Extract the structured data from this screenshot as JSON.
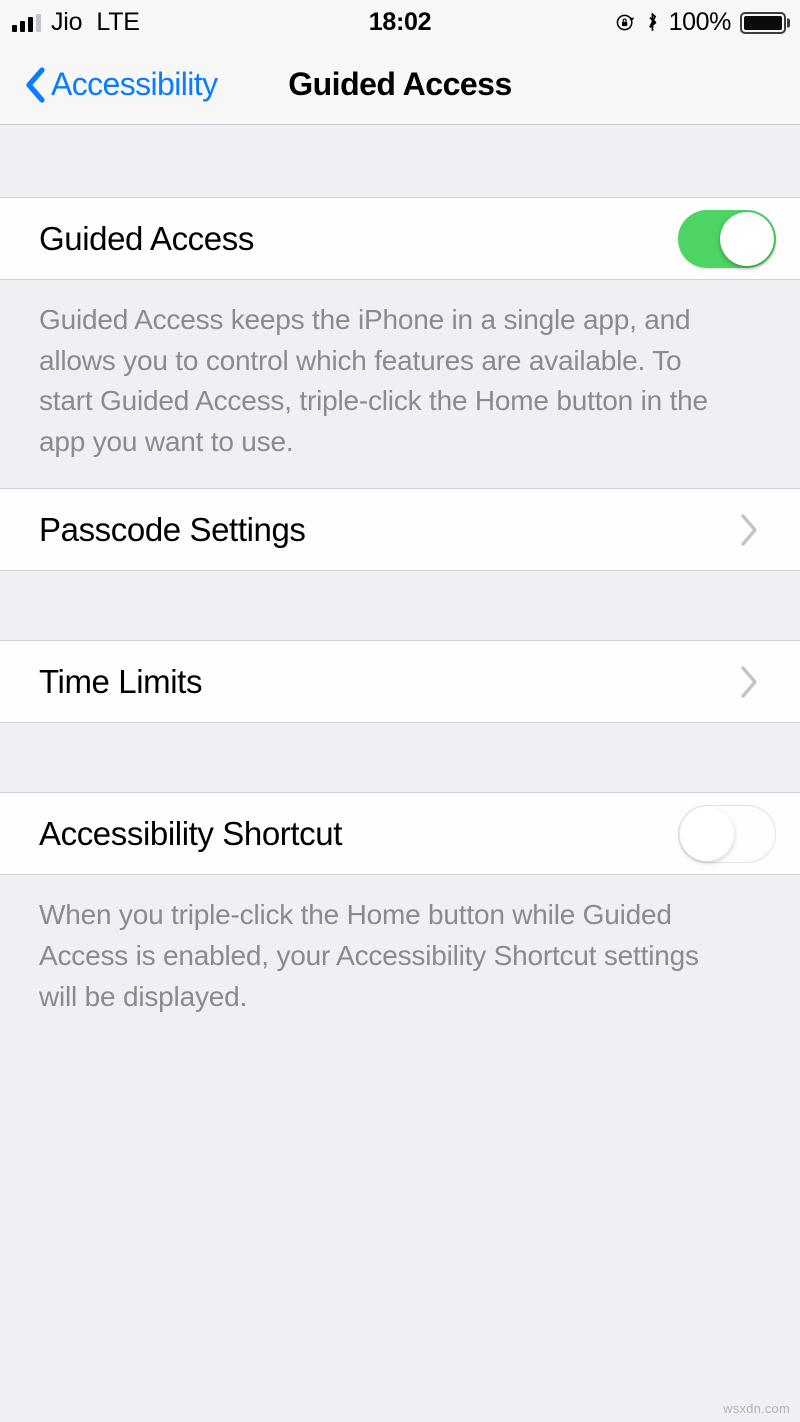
{
  "status_bar": {
    "carrier": "Jio",
    "network": "LTE",
    "time": "18:02",
    "battery_percent": "100%",
    "signal_bars_total": 4,
    "signal_bars_filled": 3,
    "icons": [
      "rotation-lock-icon",
      "bluetooth-icon",
      "battery-icon"
    ]
  },
  "nav_bar": {
    "back_label": "Accessibility",
    "title": "Guided Access",
    "back_icon": "chevron-left-icon",
    "accent_color": "#0a7cff"
  },
  "sections": [
    {
      "rows": [
        {
          "label": "Guided Access",
          "type": "switch",
          "value": "on"
        }
      ],
      "footer": "Guided Access keeps the iPhone in a single app, and allows you to control which features are available. To start Guided Access, triple-click the Home button in the app you want to use."
    },
    {
      "rows": [
        {
          "label": "Passcode Settings",
          "type": "disclosure",
          "accessory_icon": "chevron-right-icon"
        }
      ],
      "footer": ""
    },
    {
      "rows": [
        {
          "label": "Time Limits",
          "type": "disclosure",
          "accessory_icon": "chevron-right-icon"
        }
      ],
      "footer": ""
    },
    {
      "rows": [
        {
          "label": "Accessibility Shortcut",
          "type": "switch",
          "value": "off"
        }
      ],
      "footer": "When you triple-click the Home button while Guided Access is enabled, your Accessibility Shortcut settings will be displayed."
    }
  ],
  "colors": {
    "switch_on": "#4cd464",
    "background": "#efeff4",
    "cell_background": "#fefeff",
    "footer_text": "#8a8a90",
    "separator": "#d4d4d8"
  },
  "watermark": "wsxdn.com"
}
